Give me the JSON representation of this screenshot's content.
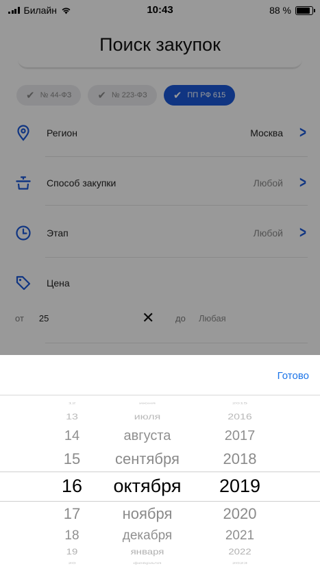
{
  "status": {
    "carrier": "Билайн",
    "time": "10:43",
    "battery_pct": "88 %",
    "battery_level": 0.88
  },
  "header": {
    "title": "Поиск закупок"
  },
  "chips": [
    {
      "label": "№ 44-ФЗ",
      "selected": false
    },
    {
      "label": "№ 223-ФЗ",
      "selected": false
    },
    {
      "label": "ПП РФ 615",
      "selected": true
    }
  ],
  "filters": {
    "region": {
      "label": "Регион",
      "value": "Москва"
    },
    "method": {
      "label": "Способ закупки",
      "value": "Любой"
    },
    "stage": {
      "label": "Этап",
      "value": "Любой"
    },
    "price": {
      "label": "Цена",
      "from_label": "от",
      "from_value": "25",
      "to_label": "до",
      "to_placeholder": "Любая"
    }
  },
  "colors": {
    "accent": "#1b59d9",
    "done_button": "#1a73e8",
    "overlay": "rgba(0,0,0,0.40)"
  },
  "picker": {
    "done_label": "Готово",
    "days": [
      "12",
      "13",
      "14",
      "15",
      "16",
      "17",
      "18",
      "19",
      "20"
    ],
    "months": [
      "июня",
      "июля",
      "августа",
      "сентября",
      "октября",
      "ноября",
      "декабря",
      "января",
      "февраля"
    ],
    "years": [
      "2015",
      "2016",
      "2017",
      "2018",
      "2019",
      "2020",
      "2021",
      "2022",
      "2023"
    ],
    "selected": {
      "day": "16",
      "month": "октября",
      "year": "2019"
    }
  }
}
